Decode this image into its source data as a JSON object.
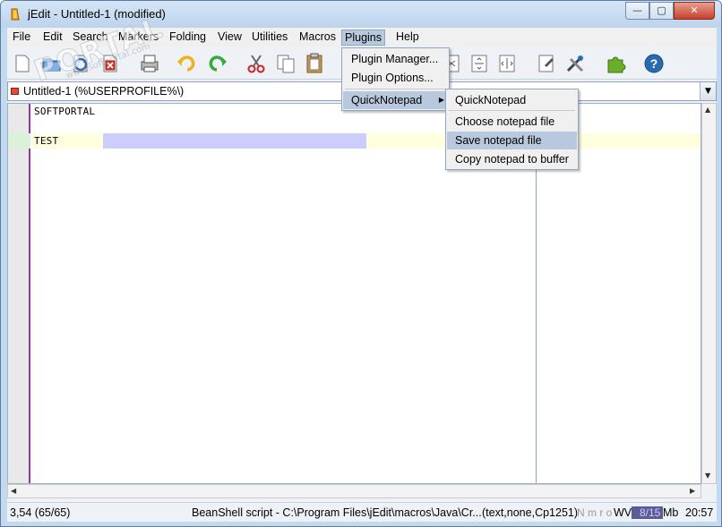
{
  "window": {
    "title": "jEdit - Untitled-1 (modified)",
    "controls": {
      "minimize": "—",
      "maximize": "▢",
      "close": "✕"
    }
  },
  "menubar": [
    {
      "label": "File"
    },
    {
      "label": "Edit"
    },
    {
      "label": "Search"
    },
    {
      "label": "Markers"
    },
    {
      "label": "Folding"
    },
    {
      "label": "View"
    },
    {
      "label": "Utilities"
    },
    {
      "label": "Macros"
    },
    {
      "label": "Plugins"
    },
    {
      "label": "Help"
    }
  ],
  "toolbar": [
    "new-file-icon",
    "open-file-icon",
    "reload-icon",
    "close-file-icon",
    "print-icon",
    "undo-icon",
    "redo-icon",
    "cut-icon",
    "copy-icon",
    "paste-icon",
    "find-icon",
    "narrow-icon",
    "fold-icon",
    "split-icon",
    "global-options-icon",
    "plugin-options-icon",
    "plugin-manager-icon",
    "help-icon"
  ],
  "buffer": {
    "label": "Untitled-1 (%USERPROFILE%\\)",
    "dropdown": "▼"
  },
  "editor": {
    "lines": [
      "SOFTPORTAL",
      "",
      "TEST"
    ]
  },
  "plugins_menu": {
    "items": [
      {
        "label": "Plugin Manager..."
      },
      {
        "label": "Plugin Options..."
      },
      {
        "label": "QuickNotepad",
        "submenu": true
      }
    ]
  },
  "quicknotepad_menu": {
    "items": [
      {
        "label": "QuickNotepad"
      },
      {
        "label": "Choose notepad file"
      },
      {
        "label": "Save notepad file"
      },
      {
        "label": "Copy notepad to buffer"
      }
    ]
  },
  "status": {
    "position": "3,54 (65/65)",
    "message": "BeanShell script - C:\\Program Files\\jEdit\\macros\\Java\\Cr...",
    "mode": "(text,none,Cp1251)",
    "flags": "N m r o",
    "wrap": "WV",
    "memory": "8/15",
    "memory_unit": "Mb",
    "time": "20:57"
  },
  "watermark": {
    "text": "PORTAL",
    "sub": "www.softportal.com"
  }
}
